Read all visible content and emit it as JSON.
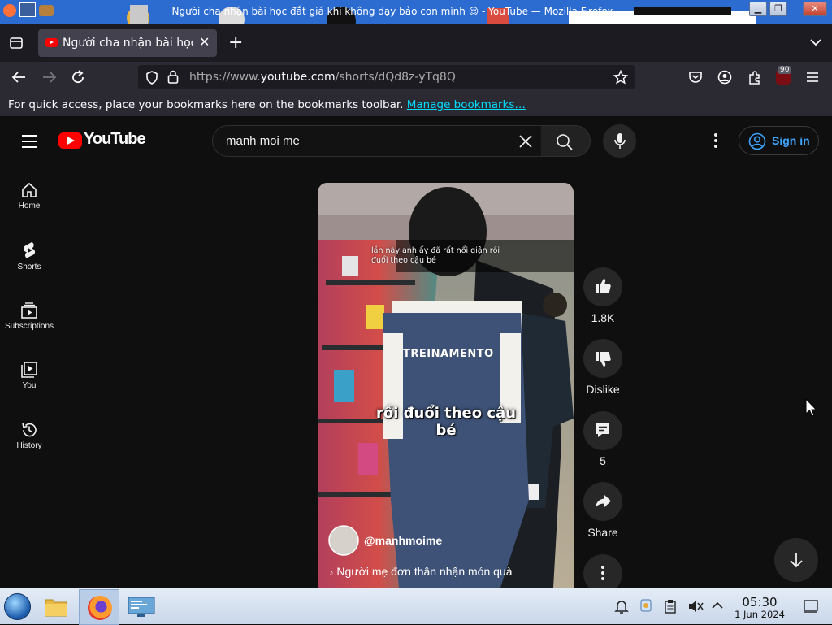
{
  "window": {
    "title": "Người cha nhận bài học đắt giá khi không dạy bảo con mình 😌 - YouTube — Mozilla Firefox"
  },
  "tabs": [
    {
      "label": "Người cha nhận bài học đắt giá khi không dạy bảo con mình",
      "active": true
    }
  ],
  "nav": {
    "url_prefix": "https://www.",
    "url_host": "youtube.com",
    "url_path": "/shorts/dQd8z-yTq8Q",
    "extension_badge": "90"
  },
  "bookmarks_bar": {
    "text": "For quick access, place your bookmarks here on the bookmarks toolbar.",
    "link": "Manage bookmarks…"
  },
  "youtube": {
    "logo_text": "YouTube",
    "search_value": "manh moi me",
    "sign_in": "Sign in",
    "sidebar": [
      {
        "label": "Home",
        "icon": "home-icon"
      },
      {
        "label": "Shorts",
        "icon": "shorts-icon"
      },
      {
        "label": "Subscriptions",
        "icon": "subscriptions-icon"
      },
      {
        "label": "You",
        "icon": "you-icon"
      },
      {
        "label": "History",
        "icon": "history-icon"
      }
    ],
    "short": {
      "caption_top": "lần này anh ấy đã rất nổi giận rồi đuổi theo cậu bé",
      "shirt_text": "TREINAMENTO",
      "subtitle": "rồi đuổi theo cậu bé",
      "channel": "@manhmoime",
      "music": "Người mẹ đơn thân nhận món quà"
    },
    "actions": {
      "like_count": "1.8K",
      "dislike_label": "Dislike",
      "comment_count": "5",
      "share_label": "Share"
    }
  },
  "taskbar": {
    "time": "05:30",
    "date": "1 Jun 2024"
  },
  "colors": {
    "yt_red": "#ff0000",
    "yt_background": "#0f0f0f",
    "signin_blue": "#3ea6ff",
    "firefox_toolbar": "#2b2a33",
    "link_cyan": "#00ddff"
  }
}
